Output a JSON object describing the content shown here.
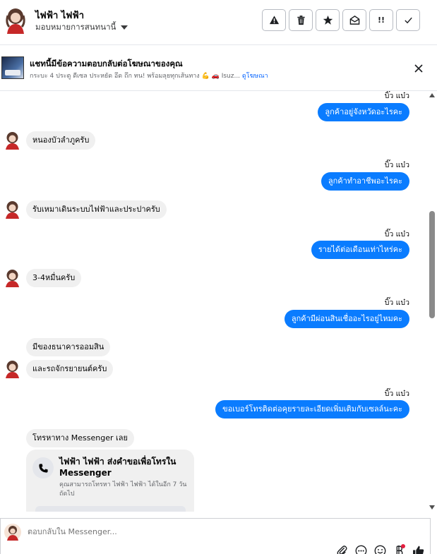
{
  "header": {
    "name": "ไฟฟ้า ไฟฟ้า",
    "assign_label": "มอบหมายการสนทนานี้"
  },
  "ad": {
    "title": "แชทนี้มีข้อความตอบกลับต่อโฆษณาของคุณ",
    "subtitle": "กระบะ 4 ประตู ดีเซล ประหยัด อึด ถึก ทน! พร้อมลุยทุกเส้นทาง 💪 🚗 Isuz...",
    "link": "ดูโฆษณา"
  },
  "messages": {
    "sender": "บิ๊ว แบ๋ว",
    "out_1": "ลูกค้าอยู่จังหวัดอะไรคะ",
    "in_1": "หนองบัวลำภูครับ",
    "out_2": "ลูกค้าทำอาชีพอะไรคะ",
    "in_2": "รับเหมาเดินระบบไฟฟ้าและประปาครับ",
    "out_3": "รายได้ต่อเดือนเท่าไหร่คะ",
    "in_3": "3-4หมื่นครับ",
    "out_4": "ลูกค้ามีผ่อนสินเชื่ออะไรอยู่ไหมคะ",
    "in_4a": "มีของธนาคารออมสิน",
    "in_4b": "และรถจักรยายนต์ครับ",
    "out_5": "ขอเบอร์โทรติดต่อคุยรายละเอียดเพิ่มเติมกับเซลล์นะคะ",
    "in_5": "โทรหาทาง Messenger เลย"
  },
  "call_card": {
    "title": "ไฟฟ้า ไฟฟ้า ส่งคำขอเพื่อโทรใน Messenger",
    "subtitle": "คุณสามารถโทรหา ไฟฟ้า ไฟฟ้า ได้ในอีก 7 วันถัดไป"
  },
  "composer": {
    "placeholder": "ตอบกลับใน Messenger..."
  },
  "colors": {
    "outgoing_bubble": "#0a7cff",
    "incoming_bubble": "#f0f0f0",
    "link": "#0866ff"
  }
}
